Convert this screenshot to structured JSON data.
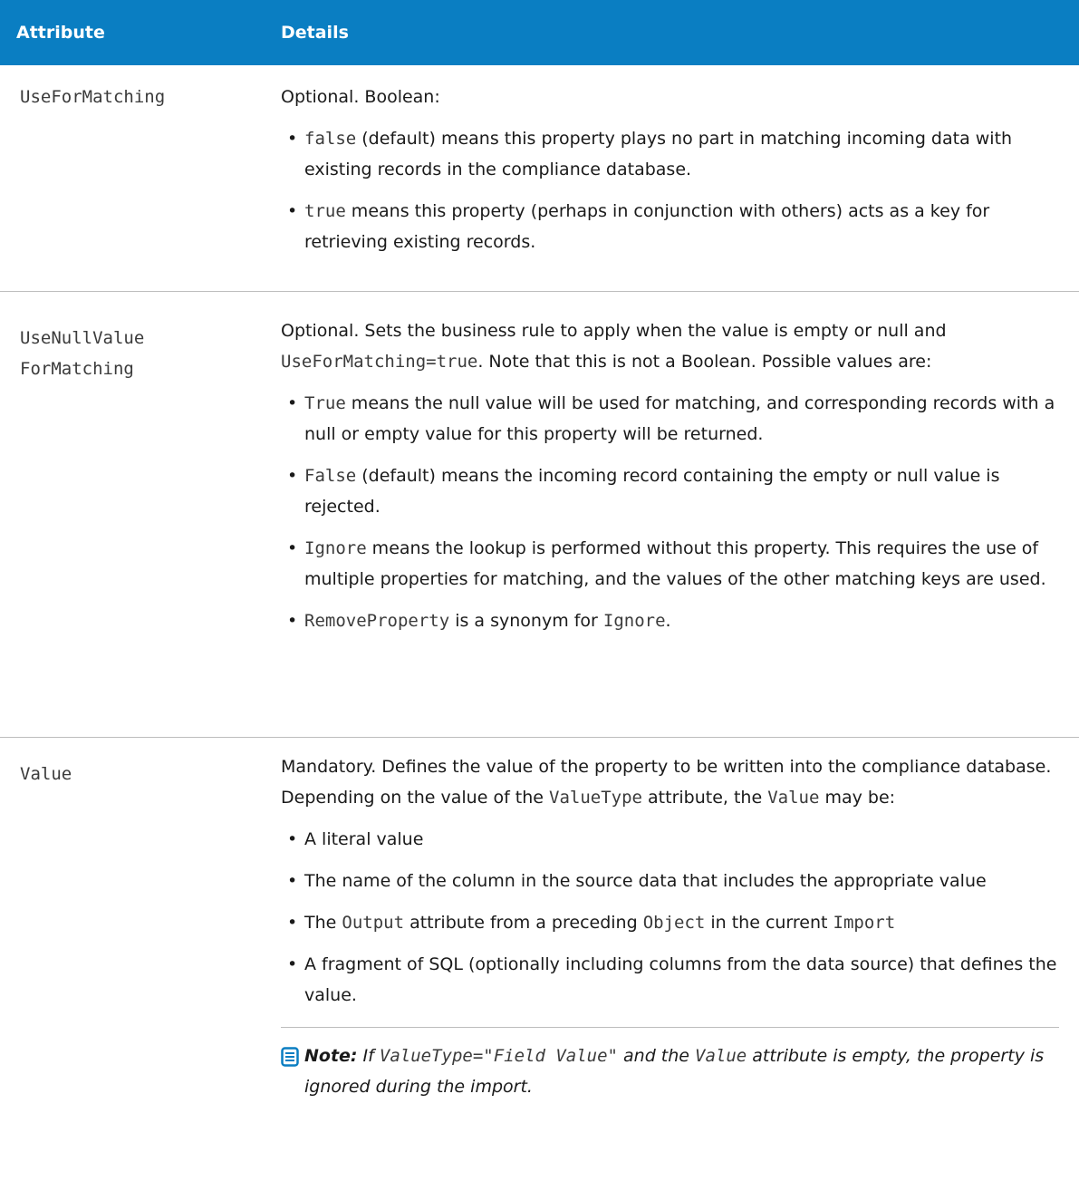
{
  "header": {
    "attribute": "Attribute",
    "details": "Details"
  },
  "rows": [
    {
      "attribute": [
        "UseForMatching"
      ],
      "intro": "Optional. Boolean:",
      "bullets": [
        {
          "code": "false",
          "text": " (default) means this property plays no part in matching incoming data with existing records in the compliance database."
        },
        {
          "code": "true",
          "text": " means this property (perhaps in conjunction with others) acts as a key for retrieving existing records."
        }
      ]
    },
    {
      "attribute": [
        "UseNullValue",
        "ForMatching"
      ],
      "intro_a": "Optional. Sets the business rule to apply when the value is empty or null and ",
      "intro_code": "UseForMatching=true",
      "intro_b": ". Note that this is not a Boolean. Possible values are:",
      "bullets": [
        {
          "code": "True",
          "text": " means the null value will be used for matching, and corresponding records with a null or empty value for this property will be returned."
        },
        {
          "code": "False",
          "text": " (default) means the incoming record containing the empty or null value is rejected."
        },
        {
          "code": "Ignore",
          "text": " means the lookup is performed without this property. This requires the use of multiple properties for matching, and the values of the other matching keys are used."
        },
        {
          "code": "RemoveProperty",
          "text": " is a synonym for ",
          "code2": "Ignore",
          "text2": "."
        }
      ]
    },
    {
      "attribute": [
        "Value"
      ],
      "intro_a": "Mandatory. Defines the value of the property to be written into the compliance database. Depending on the value of the ",
      "intro_code": "ValueType",
      "intro_b": " attribute, the ",
      "intro_code2": "Value",
      "intro_c": " may be:",
      "bullets": [
        {
          "text": "A literal value"
        },
        {
          "text": "The name of the column in the source data that includes the appropriate value"
        },
        {
          "text": "The ",
          "code": "Output",
          "text2": " attribute from a preceding ",
          "code2": "Object",
          "text3": " in the current ",
          "code3": "Import"
        },
        {
          "text": "A fragment of SQL (optionally including columns from the data source) that defines the value."
        }
      ],
      "note": {
        "icon": "note-icon",
        "label": "Note:",
        "a": "If ",
        "code": "ValueType=\"Field Value\"",
        "b": " and the ",
        "code2": "Value",
        "c": " attribute is empty, the property is ignored during the import."
      }
    }
  ],
  "bullet_char": "•",
  "colors": {
    "header_bg": "#0a7ec2",
    "header_text": "#ffffff",
    "note_icon": "#0a7ec2"
  }
}
